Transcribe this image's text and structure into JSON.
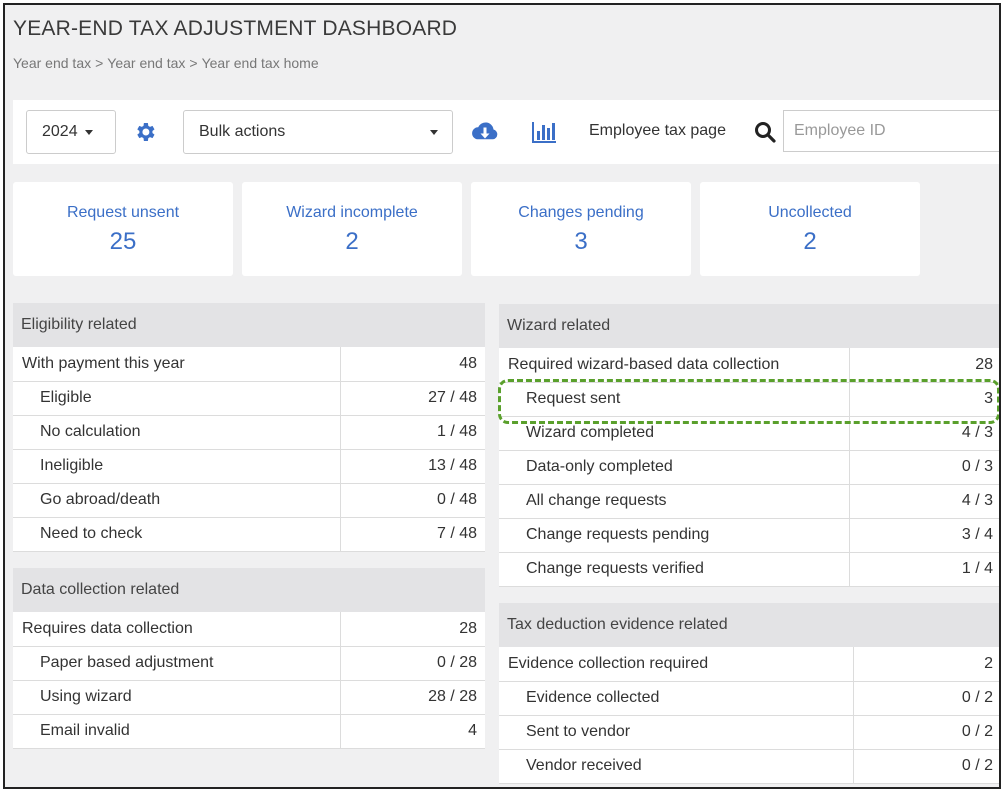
{
  "title": "YEAR-END TAX ADJUSTMENT DASHBOARD",
  "breadcrumb": [
    "Year end tax",
    "Year end tax",
    "Year end tax home"
  ],
  "breadcrumb_sep": ">",
  "toolbar": {
    "year": "2024",
    "bulk_actions": "Bulk actions",
    "employee_tax_page": "Employee tax page",
    "employee_id_placeholder": "Employee ID",
    "accent": "#3b6fc7"
  },
  "stats": [
    {
      "label": "Request unsent",
      "value": "25"
    },
    {
      "label": "Wizard incomplete",
      "value": "2"
    },
    {
      "label": "Changes pending",
      "value": "3"
    },
    {
      "label": "Uncollected",
      "value": "2"
    }
  ],
  "eligibility": {
    "title": "Eligibility related",
    "rows": [
      {
        "name": "With payment this year",
        "value": "48"
      },
      {
        "name": "Eligible",
        "value": "27 / 48"
      },
      {
        "name": "No calculation",
        "value": "1 / 48"
      },
      {
        "name": "Ineligible",
        "value": "13 / 48"
      },
      {
        "name": "Go abroad/death",
        "value": "0 / 48"
      },
      {
        "name": "Need to check",
        "value": "7 / 48"
      }
    ]
  },
  "data_collection": {
    "title": "Data collection related",
    "rows": [
      {
        "name": "Requires data collection",
        "value": "28"
      },
      {
        "name": "Paper based adjustment",
        "value": "0 / 28"
      },
      {
        "name": "Using wizard",
        "value": "28 / 28"
      },
      {
        "name": "Email invalid",
        "value": "4"
      }
    ]
  },
  "wizard": {
    "title": "Wizard related",
    "rows": [
      {
        "name": "Required wizard-based data collection",
        "value": "28"
      },
      {
        "name": "Request sent",
        "value": "3"
      },
      {
        "name": "Wizard completed",
        "value": "4 / 3"
      },
      {
        "name": "Data-only completed",
        "value": "0 / 3"
      },
      {
        "name": "All change requests",
        "value": "4 / 3"
      },
      {
        "name": "Change requests pending",
        "value": "3 / 4"
      },
      {
        "name": "Change requests verified",
        "value": "1 / 4"
      }
    ]
  },
  "evidence": {
    "title": "Tax deduction evidence related",
    "rows": [
      {
        "name": "Evidence collection required",
        "value": "2"
      },
      {
        "name": "Evidence collected",
        "value": "0 / 2"
      },
      {
        "name": "Sent to vendor",
        "value": "0 / 2"
      },
      {
        "name": "Vendor received",
        "value": "0 / 2"
      }
    ]
  },
  "highlight_color": "#5aa02c"
}
